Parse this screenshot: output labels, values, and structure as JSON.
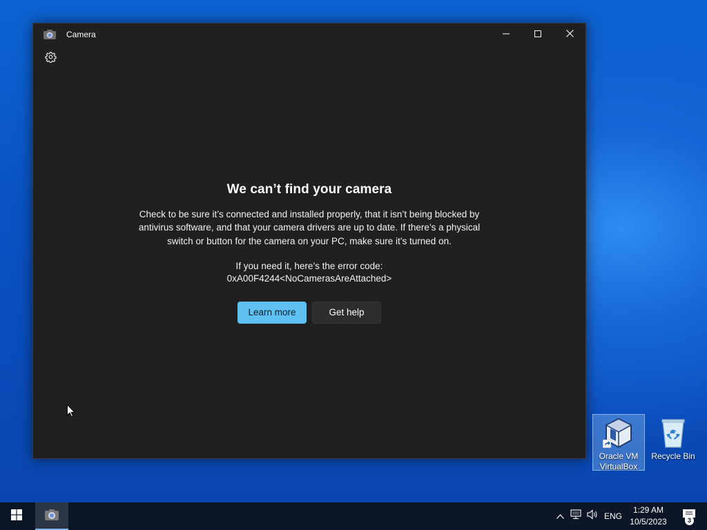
{
  "window": {
    "title": "Camera",
    "controls": {
      "minimize": "minimize",
      "maximize": "maximize",
      "close": "close"
    }
  },
  "error": {
    "heading": "We can’t find your camera",
    "description": "Check to be sure it’s connected and installed properly, that it isn’t being blocked by antivirus software, and that your camera drivers are up to date. If there’s a physical switch or button for the camera on your PC, make sure it’s turned on.",
    "code_intro": "If you need it, here’s the error code:",
    "code": "0xA00F4244<NoCamerasAreAttached>",
    "buttons": {
      "learn_more": "Learn more",
      "get_help": "Get help"
    }
  },
  "desktop": {
    "icons": [
      {
        "label_line1": "Oracle VM",
        "label_line2": "VirtualBox",
        "icon": "virtualbox-icon"
      },
      {
        "label_line1": "Recycle Bin",
        "label_line2": "",
        "icon": "recycle-bin-icon"
      }
    ]
  },
  "taskbar": {
    "language": "ENG",
    "time": "1:29 AM",
    "date": "10/5/2023",
    "notification_count": "3"
  },
  "colors": {
    "accent_button": "#5fc1f2",
    "window_bg": "#202020",
    "taskbar_bg": "#0c1626"
  }
}
